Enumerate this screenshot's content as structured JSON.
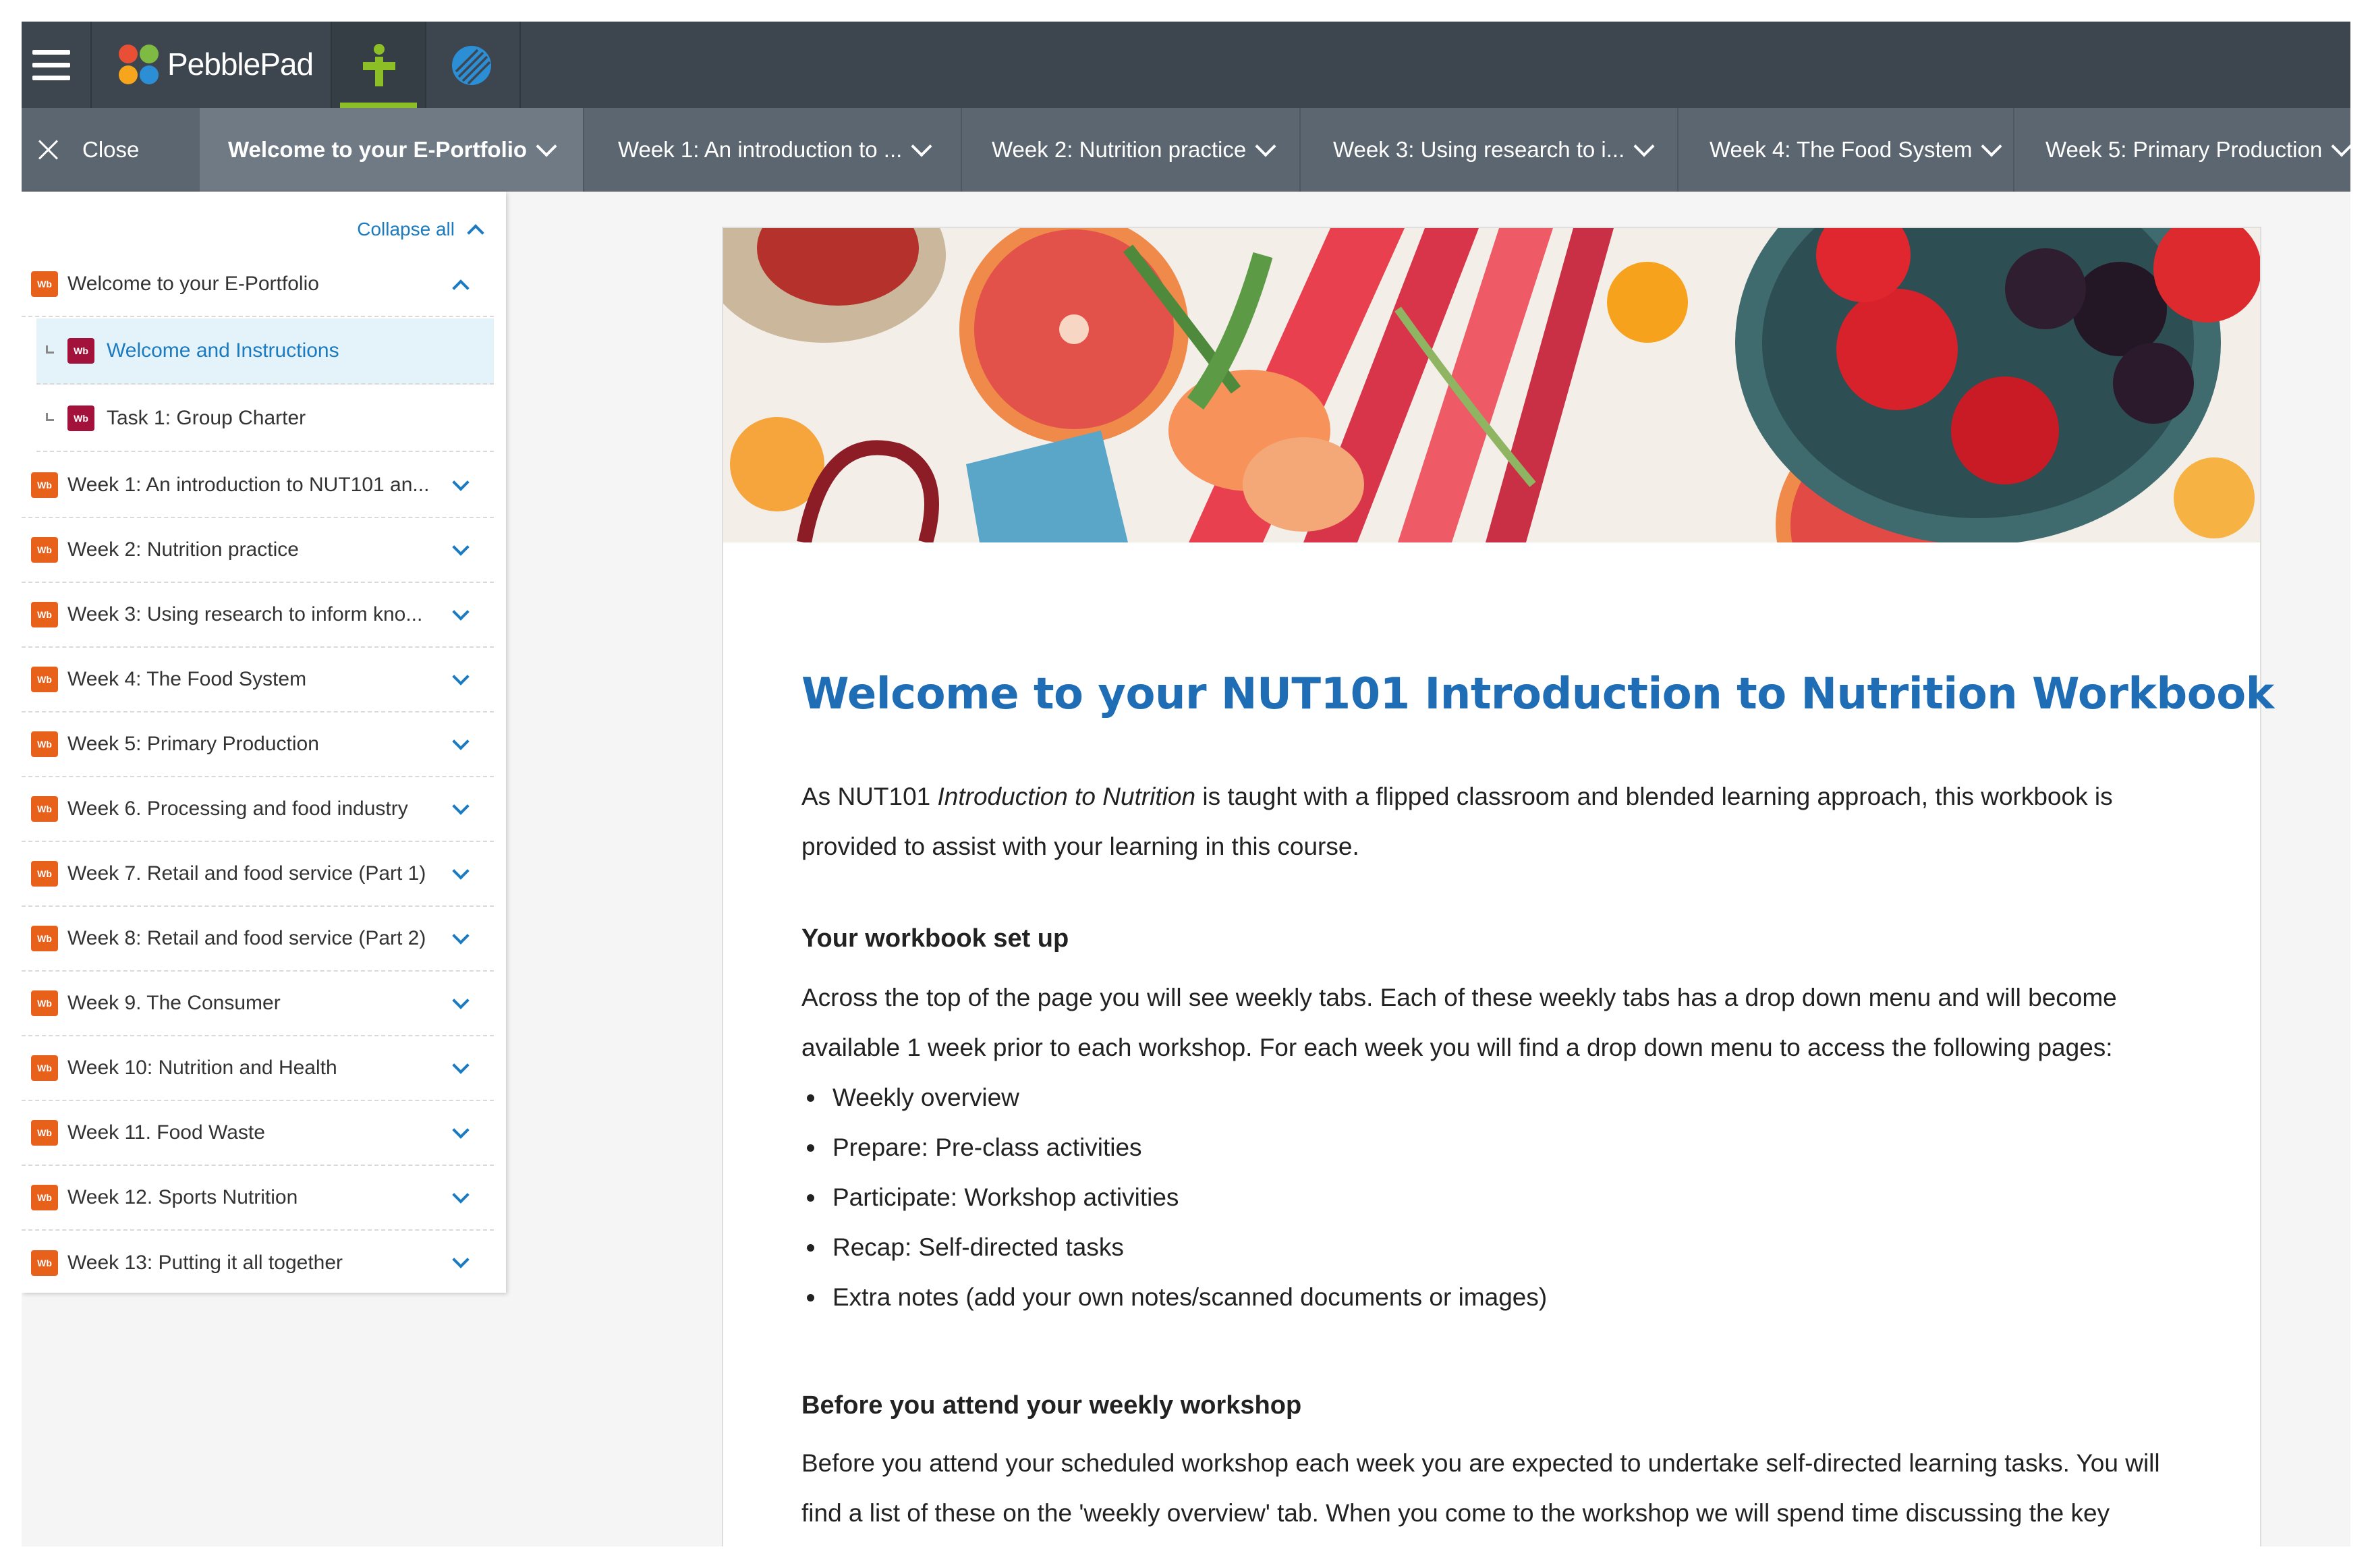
{
  "app": {
    "brand_name": "PebblePad"
  },
  "tabs": {
    "close_label": "Close",
    "items": [
      {
        "label": "Welcome to your E-Portfolio"
      },
      {
        "label": "Week 1: An introduction to ..."
      },
      {
        "label": "Week 2: Nutrition practice"
      },
      {
        "label": "Week 3: Using research to i..."
      },
      {
        "label": "Week 4: The Food System"
      },
      {
        "label": "Week 5: Primary Production"
      }
    ]
  },
  "sidebar": {
    "collapse_label": "Collapse all",
    "badge": "Wb",
    "items": [
      {
        "label": "Welcome to your E-Portfolio"
      },
      {
        "label": "Welcome and Instructions"
      },
      {
        "label": "Task 1: Group Charter"
      },
      {
        "label": "Week 1: An introduction to NUT101 an..."
      },
      {
        "label": "Week 2: Nutrition practice"
      },
      {
        "label": "Week 3: Using research to inform kno..."
      },
      {
        "label": "Week 4: The Food System"
      },
      {
        "label": "Week 5: Primary Production"
      },
      {
        "label": "Week 6. Processing and food industry"
      },
      {
        "label": "Week 7. Retail and food service (Part 1)"
      },
      {
        "label": "Week 8: Retail and food service (Part 2)"
      },
      {
        "label": "Week 9. The Consumer"
      },
      {
        "label": "Week 10: Nutrition and Health"
      },
      {
        "label": "Week 11. Food Waste"
      },
      {
        "label": "Week 12. Sports Nutrition"
      },
      {
        "label": "Week 13: Putting it all together"
      }
    ]
  },
  "content": {
    "title": "Welcome to your NUT101 Introduction to Nutrition Workbook",
    "intro_prefix": "As NUT101 ",
    "intro_italic": "Introduction to Nutrition",
    "intro_suffix": " is taught with a flipped classroom and blended learning approach, this workbook is provided to assist with your learning in this course.",
    "setup_heading": "Your workbook set up",
    "setup_text": "Across the top of the page you will see weekly tabs. Each of these weekly tabs has a drop down menu and will become available 1 week prior to each workshop. For each week you will find a drop down menu to access the following pages:",
    "bullets": [
      "Weekly overview",
      "Prepare: Pre-class activities",
      "Participate: Workshop activities",
      "Recap: Self-directed tasks",
      "Extra notes (add your own notes/scanned documents or images)"
    ],
    "before_heading": "Before you attend your weekly workshop",
    "before_text": "Before you attend your scheduled workshop each week you are expected to undertake self-directed learning tasks. You will find a list of these on the 'weekly overview' tab. When you come to the workshop we will spend time discussing the key"
  }
}
